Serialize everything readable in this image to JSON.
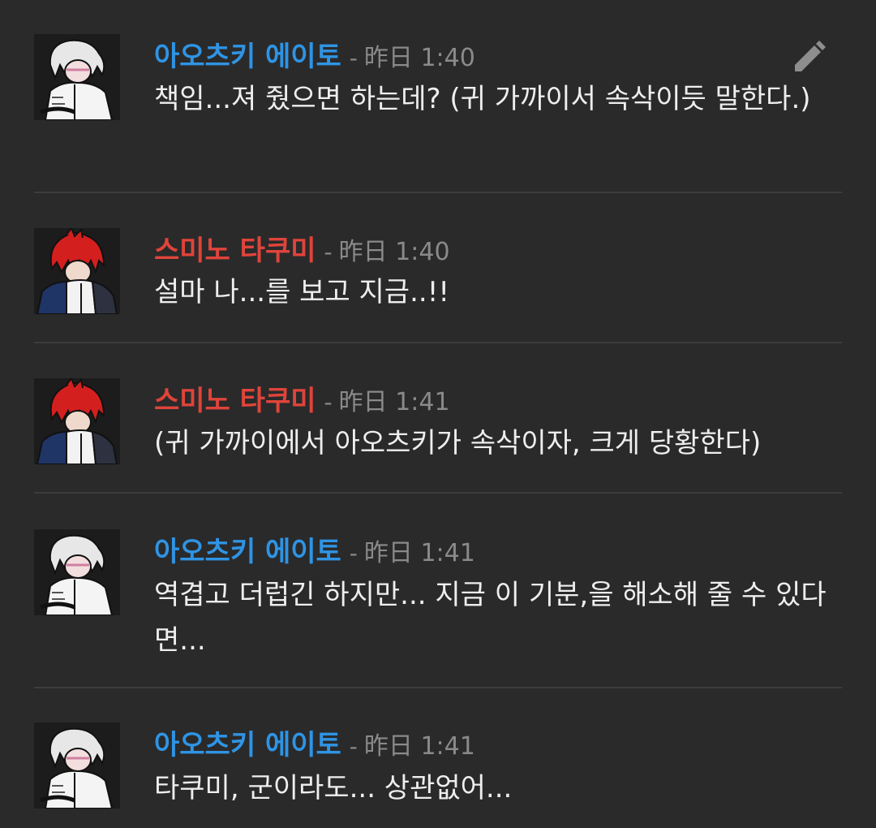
{
  "colors": {
    "background": "#2a2a2b",
    "eito_name": "#2f94e4",
    "takumi_name": "#e0443a",
    "meta_text": "#8a8a8a",
    "message_text": "#eeeeee"
  },
  "icons": {
    "edit": "pencil-icon"
  },
  "messages": [
    {
      "author": "아오츠키 에이토",
      "separator": "-",
      "time": "昨日 1:40",
      "text": "책임...져 줬으면 하는데? (귀 가까이서 속삭이듯 말한다.)"
    },
    {
      "author": "스미노 타쿠미",
      "separator": "-",
      "time": "昨日 1:40",
      "text": "설마 나...를 보고 지금..!!"
    },
    {
      "author": "스미노 타쿠미",
      "separator": "-",
      "time": "昨日 1:41",
      "text": "(귀 가까이에서 아오츠키가 속삭이자, 크게 당황한다)"
    },
    {
      "author": "아오츠키 에이토",
      "separator": "-",
      "time": "昨日 1:41",
      "text": "역겹고 더럽긴 하지만... 지금 이 기분,을 해소해 줄 수 있다면..."
    },
    {
      "author": "아오츠키 에이토",
      "separator": "-",
      "time": "昨日 1:41",
      "text": "타쿠미, 군이라도... 상관없어..."
    }
  ]
}
